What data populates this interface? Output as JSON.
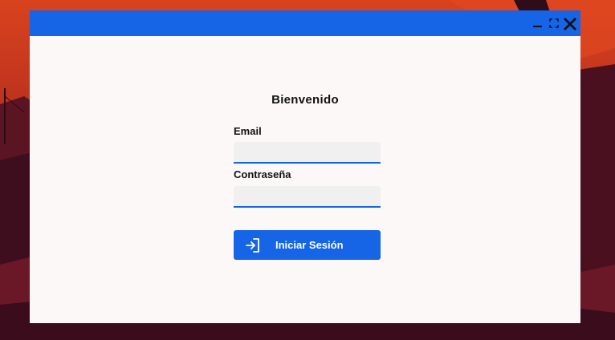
{
  "window": {
    "controls": [
      "minimize-icon",
      "maximize-icon",
      "close-icon"
    ]
  },
  "login": {
    "title": "Bienvenido",
    "email_label": "Email",
    "email_value": "",
    "password_label": "Contraseña",
    "password_value": "",
    "button_label": "Iniciar Sesión",
    "button_icon": "login-icon"
  },
  "colors": {
    "accent": "#1565e6",
    "window_bg": "#fcf8f8",
    "field_bg": "#f0f0f0"
  }
}
